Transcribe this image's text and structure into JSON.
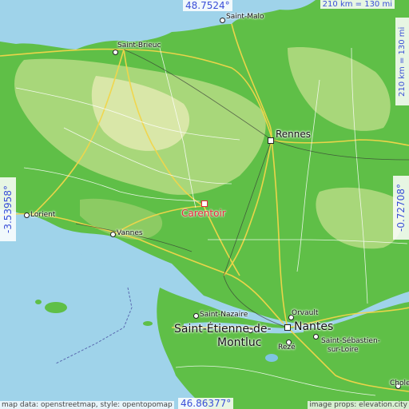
{
  "coords": {
    "north": "48.7524°",
    "south": "46.86377°",
    "west": "-3.53958°",
    "east": "-0.72708°"
  },
  "scale": {
    "horizontal": "210 km = 130 mi",
    "vertical": "210 km = 130 mi"
  },
  "focus": {
    "name": "Carentoir"
  },
  "cities": {
    "saint_malo": "Saint-Malo",
    "saint_brieuc": "Saint-Brieuc",
    "rennes": "Rennes",
    "lorient": "Lorient",
    "vannes": "Vannes",
    "saint_nazaire": "Saint-Nazaire",
    "saint_etienne_line1": "Saint-Étienne-de-",
    "saint_etienne_line2": "Montluc",
    "orvault": "Orvault",
    "nantes": "Nantes",
    "reze": "Rezé",
    "saint_sebastien_line1": "Saint-Sébastien-",
    "saint_sebastien_line2": "sur-Loire",
    "cholet": "Chole"
  },
  "attribution": {
    "left": "map data: openstreetmap, style: opentopomap",
    "right": "image props: elevation.city"
  },
  "colors": {
    "sea": "#9fd3ea",
    "lowland": "#5fbf47",
    "midland": "#a8d77a",
    "highland": "#d9e7a8",
    "road": "#f2d64a",
    "focus": "#e8293a",
    "coord_text": "#3a4fd8"
  }
}
